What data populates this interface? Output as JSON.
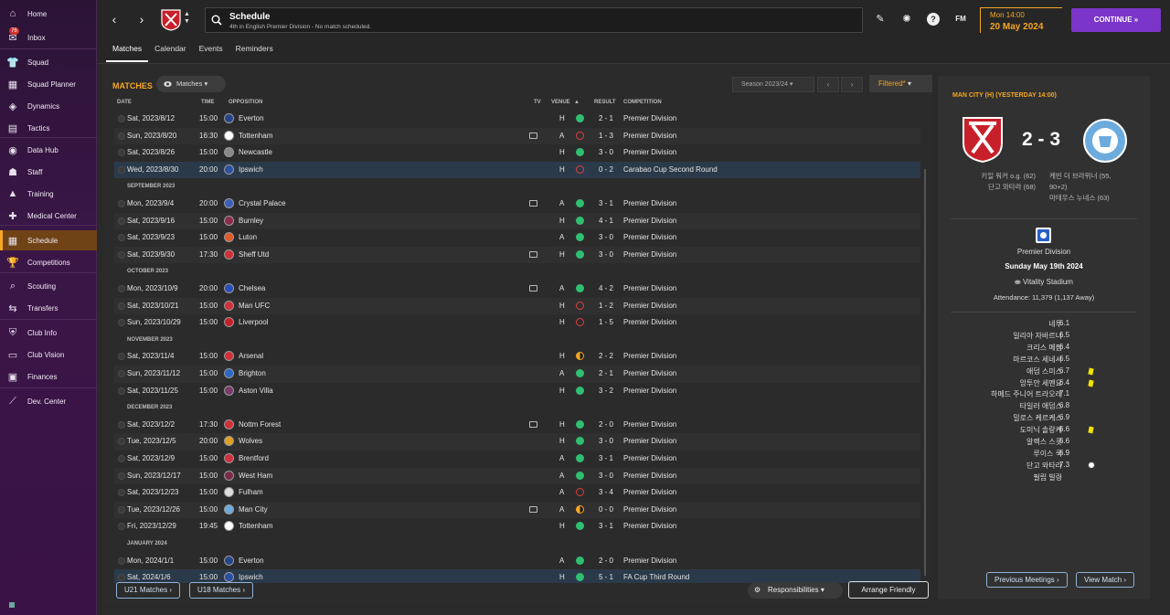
{
  "sidebar": {
    "items": [
      {
        "label": "Home",
        "icon": "home-icon",
        "glyph": "⌂"
      },
      {
        "label": "Inbox",
        "icon": "inbox-icon",
        "glyph": "✉",
        "badge": "76"
      },
      {
        "label": "Squad",
        "icon": "shirt-icon",
        "glyph": "👕"
      },
      {
        "label": "Squad Planner",
        "icon": "planner-icon",
        "glyph": "▦"
      },
      {
        "label": "Dynamics",
        "icon": "dynamics-icon",
        "glyph": "◈"
      },
      {
        "label": "Tactics",
        "icon": "tactics-icon",
        "glyph": "▤"
      },
      {
        "label": "Data Hub",
        "icon": "data-hub-icon",
        "glyph": "◉"
      },
      {
        "label": "Staff",
        "icon": "staff-icon",
        "glyph": "☗"
      },
      {
        "label": "Training",
        "icon": "training-icon",
        "glyph": "▲"
      },
      {
        "label": "Medical Center",
        "icon": "medical-icon",
        "glyph": "✚"
      },
      {
        "label": "Schedule",
        "icon": "calendar-icon",
        "glyph": "▦"
      },
      {
        "label": "Competitions",
        "icon": "trophy-icon",
        "glyph": "🏆"
      },
      {
        "label": "Scouting",
        "icon": "scouting-icon",
        "glyph": "⌕"
      },
      {
        "label": "Transfers",
        "icon": "transfers-icon",
        "glyph": "⇆"
      },
      {
        "label": "Club Info",
        "icon": "club-info-icon",
        "glyph": "⛨"
      },
      {
        "label": "Club Vision",
        "icon": "club-vision-icon",
        "glyph": "▭"
      },
      {
        "label": "Finances",
        "icon": "finances-icon",
        "glyph": "▣"
      },
      {
        "label": "Dev. Center",
        "icon": "dev-center-icon",
        "glyph": "⟋"
      }
    ]
  },
  "header": {
    "title": "Schedule",
    "subtitle": "4th in English Premier Division - No match scheduled.",
    "time": "Mon 14:00",
    "date": "20 May 2024",
    "continue_label": "CONTINUE",
    "fm_label": "FM",
    "help_label": "?",
    "tabs": [
      "Matches",
      "Calendar",
      "Events",
      "Reminders"
    ]
  },
  "main": {
    "title": "MATCHES",
    "view_dropdown": "Matches",
    "season": "Season 2023/24",
    "filtered": "Filtered*",
    "columns": {
      "date": "DATE",
      "time": "TIME",
      "opposition": "OPPOSITION",
      "tv": "TV",
      "venue": "VENUE",
      "result": "RESULT",
      "competition": "COMPETITION"
    },
    "rows": [
      {
        "date": "Sat, 2023/8/12",
        "time": "15:00",
        "opp": "Everton",
        "crest": "#274488",
        "tv": false,
        "venue": "H",
        "res": "W",
        "score": "2 - 1",
        "comp": "Premier Division"
      },
      {
        "date": "Sun, 2023/8/20",
        "time": "16:30",
        "opp": "Tottenham",
        "crest": "#ffffff",
        "tv": true,
        "venue": "A",
        "res": "L",
        "score": "1 - 3",
        "comp": "Premier Division"
      },
      {
        "date": "Sat, 2023/8/26",
        "time": "15:00",
        "opp": "Newcastle",
        "crest": "#888888",
        "tv": false,
        "venue": "H",
        "res": "W",
        "score": "3 - 0",
        "comp": "Premier Division"
      },
      {
        "date": "Wed, 2023/8/30",
        "time": "20:00",
        "opp": "Ipswich",
        "crest": "#2a4fa3",
        "tv": false,
        "venue": "H",
        "res": "L",
        "score": "0 - 2",
        "comp": "Carabao Cup Second Round",
        "sel": true
      },
      {
        "month": "SEPTEMBER 2023"
      },
      {
        "date": "Mon, 2023/9/4",
        "time": "20:00",
        "opp": "Crystal Palace",
        "crest": "#3b5fb8",
        "tv": true,
        "venue": "A",
        "res": "W",
        "score": "3 - 1",
        "comp": "Premier Division"
      },
      {
        "date": "Sat, 2023/9/16",
        "time": "15:00",
        "opp": "Burnley",
        "crest": "#8c2b4a",
        "tv": false,
        "venue": "H",
        "res": "W",
        "score": "4 - 1",
        "comp": "Premier Division"
      },
      {
        "date": "Sat, 2023/9/23",
        "time": "15:00",
        "opp": "Luton",
        "crest": "#e05a2a",
        "tv": false,
        "venue": "A",
        "res": "W",
        "score": "3 - 0",
        "comp": "Premier Division"
      },
      {
        "date": "Sat, 2023/9/30",
        "time": "17:30",
        "opp": "Sheff Utd",
        "crest": "#d0303a",
        "tv": true,
        "venue": "H",
        "res": "W",
        "score": "3 - 0",
        "comp": "Premier Division"
      },
      {
        "month": "OCTOBER 2023"
      },
      {
        "date": "Mon, 2023/10/9",
        "time": "20:00",
        "opp": "Chelsea",
        "crest": "#2a4fb8",
        "tv": true,
        "venue": "A",
        "res": "W",
        "score": "4 - 2",
        "comp": "Premier Division"
      },
      {
        "date": "Sat, 2023/10/21",
        "time": "15:00",
        "opp": "Man UFC",
        "crest": "#d0303a",
        "tv": false,
        "venue": "H",
        "res": "L",
        "score": "1 - 2",
        "comp": "Premier Division"
      },
      {
        "date": "Sun, 2023/10/29",
        "time": "15:00",
        "opp": "Liverpool",
        "crest": "#c8202a",
        "tv": false,
        "venue": "H",
        "res": "L",
        "score": "1 - 5",
        "comp": "Premier Division"
      },
      {
        "month": "NOVEMBER 2023"
      },
      {
        "date": "Sat, 2023/11/4",
        "time": "15:00",
        "opp": "Arsenal",
        "crest": "#d0303a",
        "tv": false,
        "venue": "H",
        "res": "D",
        "score": "2 - 2",
        "comp": "Premier Division"
      },
      {
        "date": "Sun, 2023/11/12",
        "time": "15:00",
        "opp": "Brighton",
        "crest": "#2a68c8",
        "tv": false,
        "venue": "A",
        "res": "W",
        "score": "2 - 1",
        "comp": "Premier Division"
      },
      {
        "date": "Sat, 2023/11/25",
        "time": "15:00",
        "opp": "Aston Villa",
        "crest": "#7a3a6a",
        "tv": false,
        "venue": "H",
        "res": "W",
        "score": "3 - 2",
        "comp": "Premier Division"
      },
      {
        "month": "DECEMBER 2023"
      },
      {
        "date": "Sat, 2023/12/2",
        "time": "17:30",
        "opp": "Nottm Forest",
        "crest": "#d0303a",
        "tv": true,
        "venue": "H",
        "res": "W",
        "score": "2 - 0",
        "comp": "Premier Division"
      },
      {
        "date": "Tue, 2023/12/5",
        "time": "20:00",
        "opp": "Wolves",
        "crest": "#e0a020",
        "tv": false,
        "venue": "H",
        "res": "W",
        "score": "3 - 0",
        "comp": "Premier Division"
      },
      {
        "date": "Sat, 2023/12/9",
        "time": "15:00",
        "opp": "Brentford",
        "crest": "#d0303a",
        "tv": false,
        "venue": "A",
        "res": "W",
        "score": "3 - 1",
        "comp": "Premier Division"
      },
      {
        "date": "Sun, 2023/12/17",
        "time": "15:00",
        "opp": "West Ham",
        "crest": "#7a2a4a",
        "tv": false,
        "venue": "A",
        "res": "W",
        "score": "3 - 0",
        "comp": "Premier Division"
      },
      {
        "date": "Sat, 2023/12/23",
        "time": "15:00",
        "opp": "Fulham",
        "crest": "#dddddd",
        "tv": false,
        "venue": "A",
        "res": "L",
        "score": "3 - 4",
        "comp": "Premier Division"
      },
      {
        "date": "Tue, 2023/12/26",
        "time": "15:00",
        "opp": "Man City",
        "crest": "#6cabdd",
        "tv": true,
        "venue": "A",
        "res": "D",
        "score": "0 - 0",
        "comp": "Premier Division"
      },
      {
        "date": "Fri, 2023/12/29",
        "time": "19:45",
        "opp": "Tottenham",
        "crest": "#ffffff",
        "tv": false,
        "venue": "H",
        "res": "W",
        "score": "3 - 1",
        "comp": "Premier Division"
      },
      {
        "month": "JANUARY 2024"
      },
      {
        "date": "Mon, 2024/1/1",
        "time": "15:00",
        "opp": "Everton",
        "crest": "#274488",
        "tv": false,
        "venue": "A",
        "res": "W",
        "score": "2 - 0",
        "comp": "Premier Division"
      },
      {
        "date": "Sat, 2024/1/6",
        "time": "15:00",
        "opp": "Ipswich",
        "crest": "#2a4fa3",
        "tv": false,
        "venue": "H",
        "res": "W",
        "score": "5 - 1",
        "comp": "FA Cup Third Round",
        "sel": true
      }
    ],
    "footer": {
      "u21": "U21 Matches",
      "u18": "U18 Matches",
      "responsibilities": "Responsibilities",
      "arrange": "Arrange Friendly"
    }
  },
  "match": {
    "title": "MAN CITY (H) (YESTERDAY 14:00)",
    "score": "2 - 3",
    "home_scorers": [
      "키일 워커 o.g. (62)",
      "단고 와타라 (68)"
    ],
    "away_scorers": [
      "케빈 더 브라위너 (55,",
      "90+2)",
      "마테우스 누네스 (63)"
    ],
    "competition": "Premier Division",
    "date": "Sunday May 19th 2024",
    "stadium": "Vitality Stadium",
    "attendance": "Attendance: 11,379 (1,137 Away)",
    "players": [
      {
        "name": "네투",
        "rating": "6.1"
      },
      {
        "name": "일리아 자바르니",
        "rating": "6.5"
      },
      {
        "name": "크리스 메팜",
        "rating": "6.4"
      },
      {
        "name": "마르코스 세네시",
        "rating": "6.5"
      },
      {
        "name": "애덤 스미스",
        "rating": "6.7",
        "card": true
      },
      {
        "name": "앙투안 세멘요",
        "rating": "6.4",
        "card": true
      },
      {
        "name": "하메드 주니어 트라오레",
        "rating": "7.1"
      },
      {
        "name": "타일러 애덤스",
        "rating": "6.8"
      },
      {
        "name": "밀로스 케르케스",
        "rating": "6.9"
      },
      {
        "name": "도미닉 솔랑케",
        "rating": "6.6",
        "card": true
      },
      {
        "name": "알렉스 스콧",
        "rating": "6.6"
      },
      {
        "name": "루이스 쿡",
        "rating": "6.9"
      },
      {
        "name": "단고 와타라",
        "rating": "7.3",
        "goal": true
      },
      {
        "name": "필립 빌링",
        "rating": "-"
      }
    ],
    "prev_meetings": "Previous Meetings",
    "view_match": "View Match"
  }
}
